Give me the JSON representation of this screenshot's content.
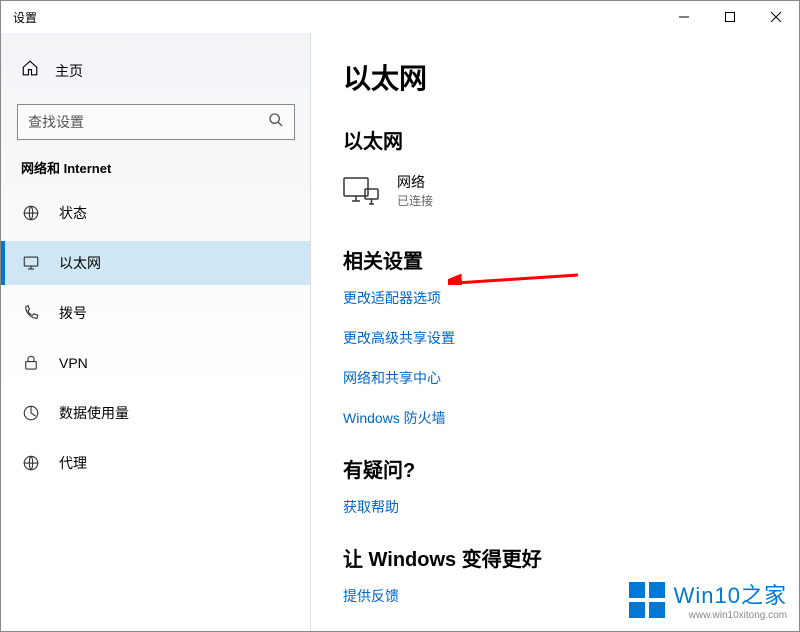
{
  "window": {
    "title": "设置"
  },
  "sidebar": {
    "home_label": "主页",
    "search_placeholder": "查找设置",
    "section": "网络和 Internet",
    "items": [
      {
        "label": "状态"
      },
      {
        "label": "以太网"
      },
      {
        "label": "拨号"
      },
      {
        "label": "VPN"
      },
      {
        "label": "数据使用量"
      },
      {
        "label": "代理"
      }
    ]
  },
  "main": {
    "page_title": "以太网",
    "ethernet": {
      "heading": "以太网",
      "name": "网络",
      "status": "已连接"
    },
    "related": {
      "heading": "相关设置",
      "links": [
        "更改适配器选项",
        "更改高级共享设置",
        "网络和共享中心",
        "Windows 防火墙"
      ]
    },
    "help": {
      "heading": "有疑问?",
      "link": "获取帮助"
    },
    "feedback": {
      "heading": "让 Windows 变得更好",
      "link": "提供反馈"
    }
  },
  "watermark": {
    "brand": "Win10之家",
    "url": "www.win10xitong.com"
  }
}
